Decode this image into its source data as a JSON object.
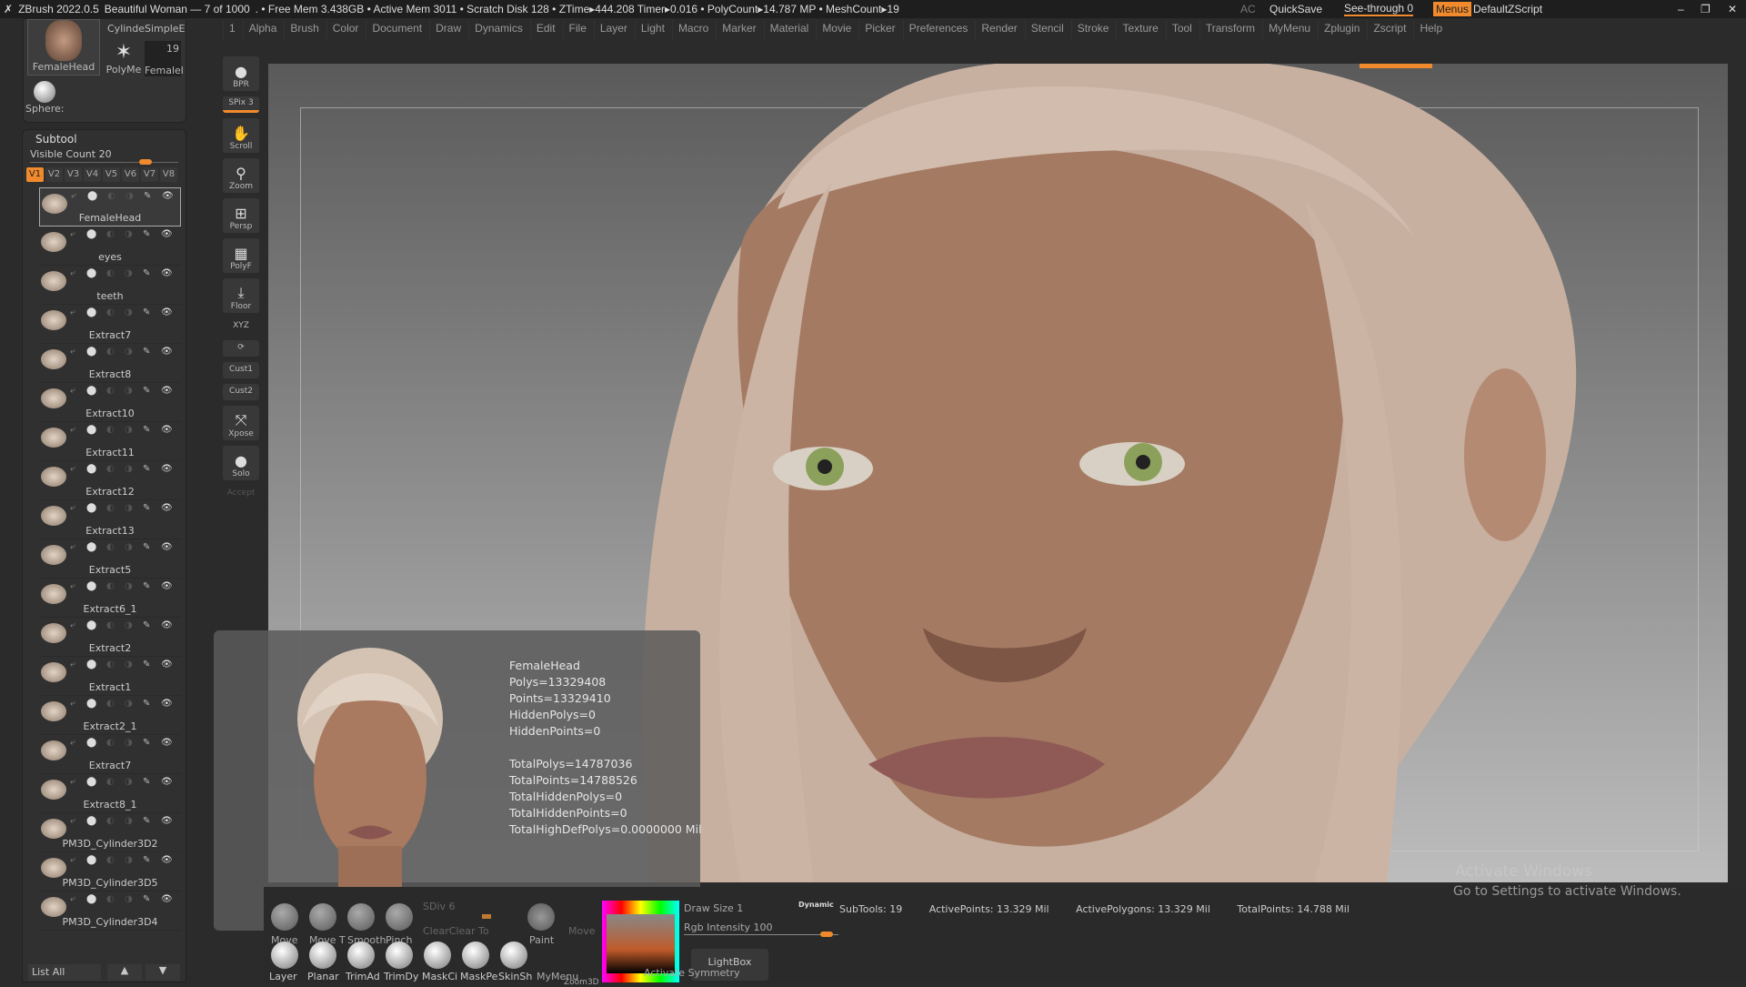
{
  "title": {
    "app": "ZBrush 2022.0.5",
    "doc": "Beautiful Woman — 7 of 1000",
    "stats": ". • Free Mem 3.438GB • Active Mem 3011 • Scratch Disk 128 • ZTime▸444.208 Timer▸0.016 • PolyCount▸14.787 MP • MeshCount▸19",
    "ac": "AC",
    "quicksave": "QuickSave",
    "seethrough": "See-through  0",
    "menus": "Menus",
    "zscript": "DefaultZScript"
  },
  "menus": [
    "1",
    "Alpha",
    "Brush",
    "Color",
    "Document",
    "Draw",
    "Dynamics",
    "Edit",
    "File",
    "Layer",
    "Light",
    "Macro",
    "Marker",
    "Material",
    "Movie",
    "Picker",
    "Preferences",
    "Render",
    "Stencil",
    "Stroke",
    "Texture",
    "Tool",
    "Transform",
    "MyMenu",
    "Zplugin",
    "Zscript",
    "Help"
  ],
  "tools": {
    "main": "FemaleHead",
    "cyl": "Cylinde",
    "simple": "SimpleE",
    "poly": "PolyMe",
    "female": "Femalel",
    "female_count": "19",
    "sphere": "Sphere:"
  },
  "subtool": {
    "title": "Subtool",
    "visible": "Visible Count 20",
    "visible_value": 20,
    "vtabs": [
      "V1",
      "V2",
      "V3",
      "V4",
      "V5",
      "V6",
      "V7",
      "V8"
    ],
    "items": [
      "FemaleHead",
      "eyes",
      "teeth",
      "Extract7",
      "Extract8",
      "Extract10",
      "Extract11",
      "Extract12",
      "Extract13",
      "Extract5",
      "Extract6_1",
      "Extract2",
      "Extract1",
      "Extract2_1",
      "Extract7",
      "Extract8_1",
      "PM3D_Cylinder3D2",
      "PM3D_Cylinder3D5",
      "PM3D_Cylinder3D4"
    ],
    "list_all": "List All"
  },
  "shelf": {
    "bpr": "BPR",
    "spix": "SPix 3",
    "scroll": "Scroll",
    "zoom": "Zoom",
    "persp": "Persp",
    "polyf": "PolyF",
    "floor": "Floor",
    "xyz": "XYZ",
    "cust1": "Cust1",
    "cust2": "Cust2",
    "xpose": "Xpose",
    "dynamic": "Dynamic",
    "solo": "Solo",
    "accept": "Accept"
  },
  "popup": {
    "lines": "FemaleHead\nPolys=13329408\nPoints=13329410\nHiddenPolys=0\nHiddenPoints=0\n\nTotalPolys=14787036\nTotalPoints=14788526\nTotalHiddenPolys=0\nTotalHiddenPoints=0\nTotalHighDefPolys=0.0000000 Mil"
  },
  "bottom": {
    "brushes1": [
      "Move",
      "Move T",
      "Smooth",
      "Pinch"
    ],
    "brushes2": [
      "Layer",
      "Planar",
      "TrimAd",
      "TrimDy",
      "MaskCi",
      "MaskPe",
      "SkinSh"
    ],
    "sdiv": "SDiv 6",
    "clear": "ClearClear To",
    "paint": "Paint",
    "move": "Move",
    "mymenu": "MyMenu",
    "zoom3d": "Zoom3D",
    "drawsize": "Draw Size 1",
    "dynamic": "Dynamic",
    "rgb": "Rgb Intensity 100",
    "lightbox": "LightBox",
    "symmetry": "Activate Symmetry",
    "subtools": "SubTools: 19",
    "activepoints": "ActivePoints: 13.329 Mil",
    "activepolys": "ActivePolygons: 13.329 Mil",
    "totalpoints": "TotalPoints: 14.788 Mil"
  },
  "watermark": {
    "title": "Activate Windows",
    "sub": "Go to Settings to activate Windows."
  }
}
